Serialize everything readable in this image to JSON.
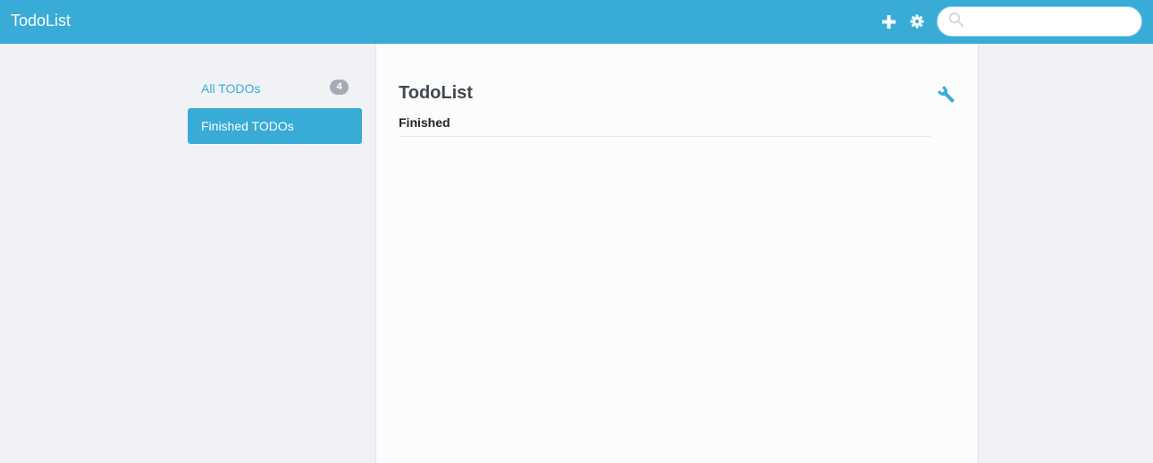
{
  "navbar": {
    "brand": "TodoList",
    "add_icon": "plus-icon",
    "settings_icon": "gear-icon",
    "search": {
      "value": "",
      "placeholder": "",
      "icon": "search-icon"
    }
  },
  "sidebar": {
    "items": [
      {
        "label": "All TODOs",
        "badge": "4",
        "active": false
      },
      {
        "label": "Finished TODOs",
        "active": true
      }
    ]
  },
  "main": {
    "title": "TodoList",
    "tools_icon": "wrench-icon",
    "section_heading": "Finished"
  },
  "colors": {
    "accent": "#38acd7",
    "badge": "#a5abb5",
    "background": "#f1f2f6",
    "panel": "#fcfcfc"
  }
}
